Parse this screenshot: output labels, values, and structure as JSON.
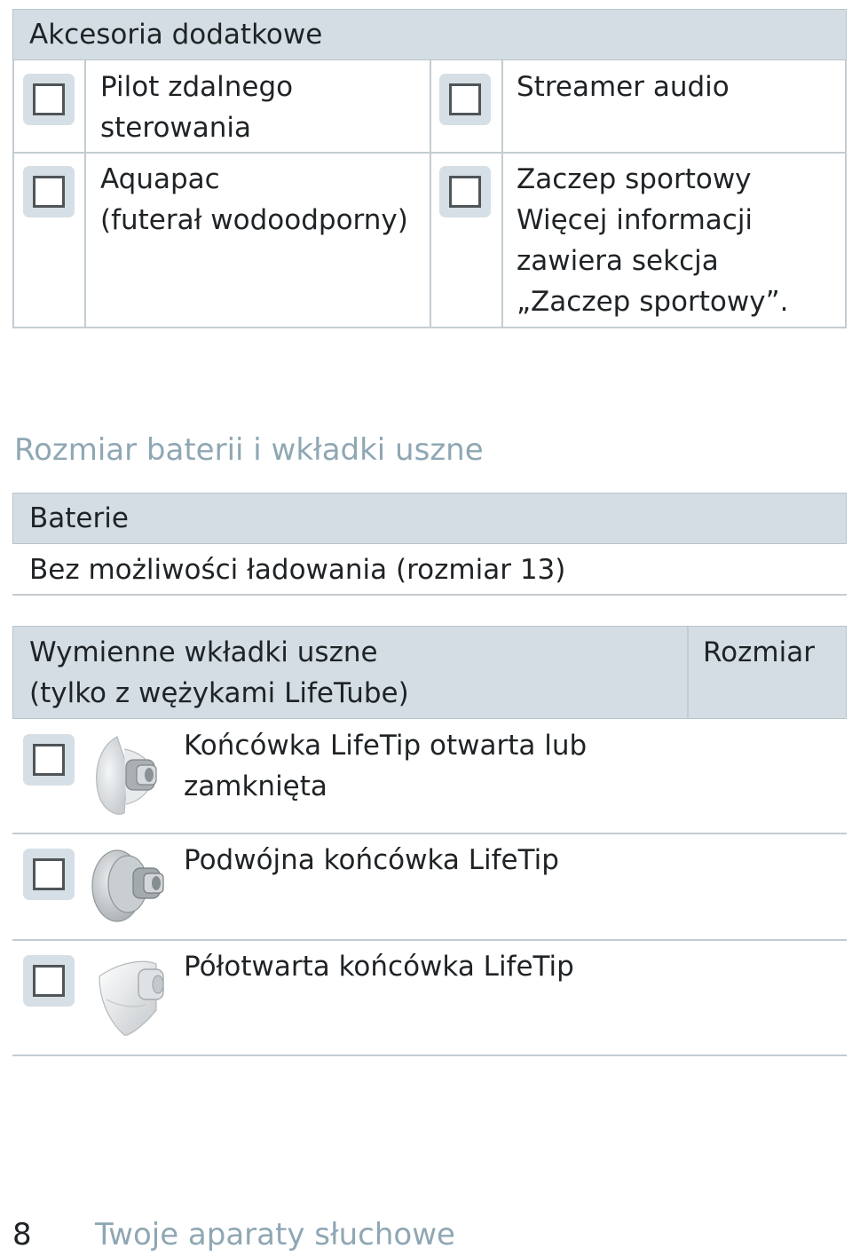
{
  "accessories": {
    "header": "Akcesoria dodatkowe",
    "items": [
      {
        "label": "Pilot zdalnego\nsterowania"
      },
      {
        "label": "Streamer audio"
      },
      {
        "label": "Aquapac\n(futerał wodoodporny)"
      },
      {
        "label": "Zaczep sportowy\nWięcej informacji\nzawiera sekcja\n„Zaczep sportowy”."
      }
    ]
  },
  "battery_section": {
    "title": "Rozmiar baterii i wkładki uszne",
    "header": "Baterie",
    "value": "Bez możliwości ładowania (rozmiar 13)"
  },
  "ear_tips": {
    "header": "Wymienne wkładki uszne\n(tylko z wężykami LifeTube)",
    "size_header": "Rozmiar",
    "items": [
      {
        "label": "Końcówka LifeTip otwarta lub\nzamknięta",
        "icon": "open-dome-icon"
      },
      {
        "label": "Podwójna końcówka LifeTip",
        "icon": "double-dome-icon"
      },
      {
        "label": "Półotwarta końcówka LifeTip",
        "icon": "semi-open-dome-icon"
      }
    ]
  },
  "footer": {
    "page_number": "8",
    "title": "Twoje aparaty słuchowe"
  },
  "colors": {
    "header_bg": "#d3dde3",
    "section_title": "#8fa7b4",
    "text": "#1f2326"
  }
}
